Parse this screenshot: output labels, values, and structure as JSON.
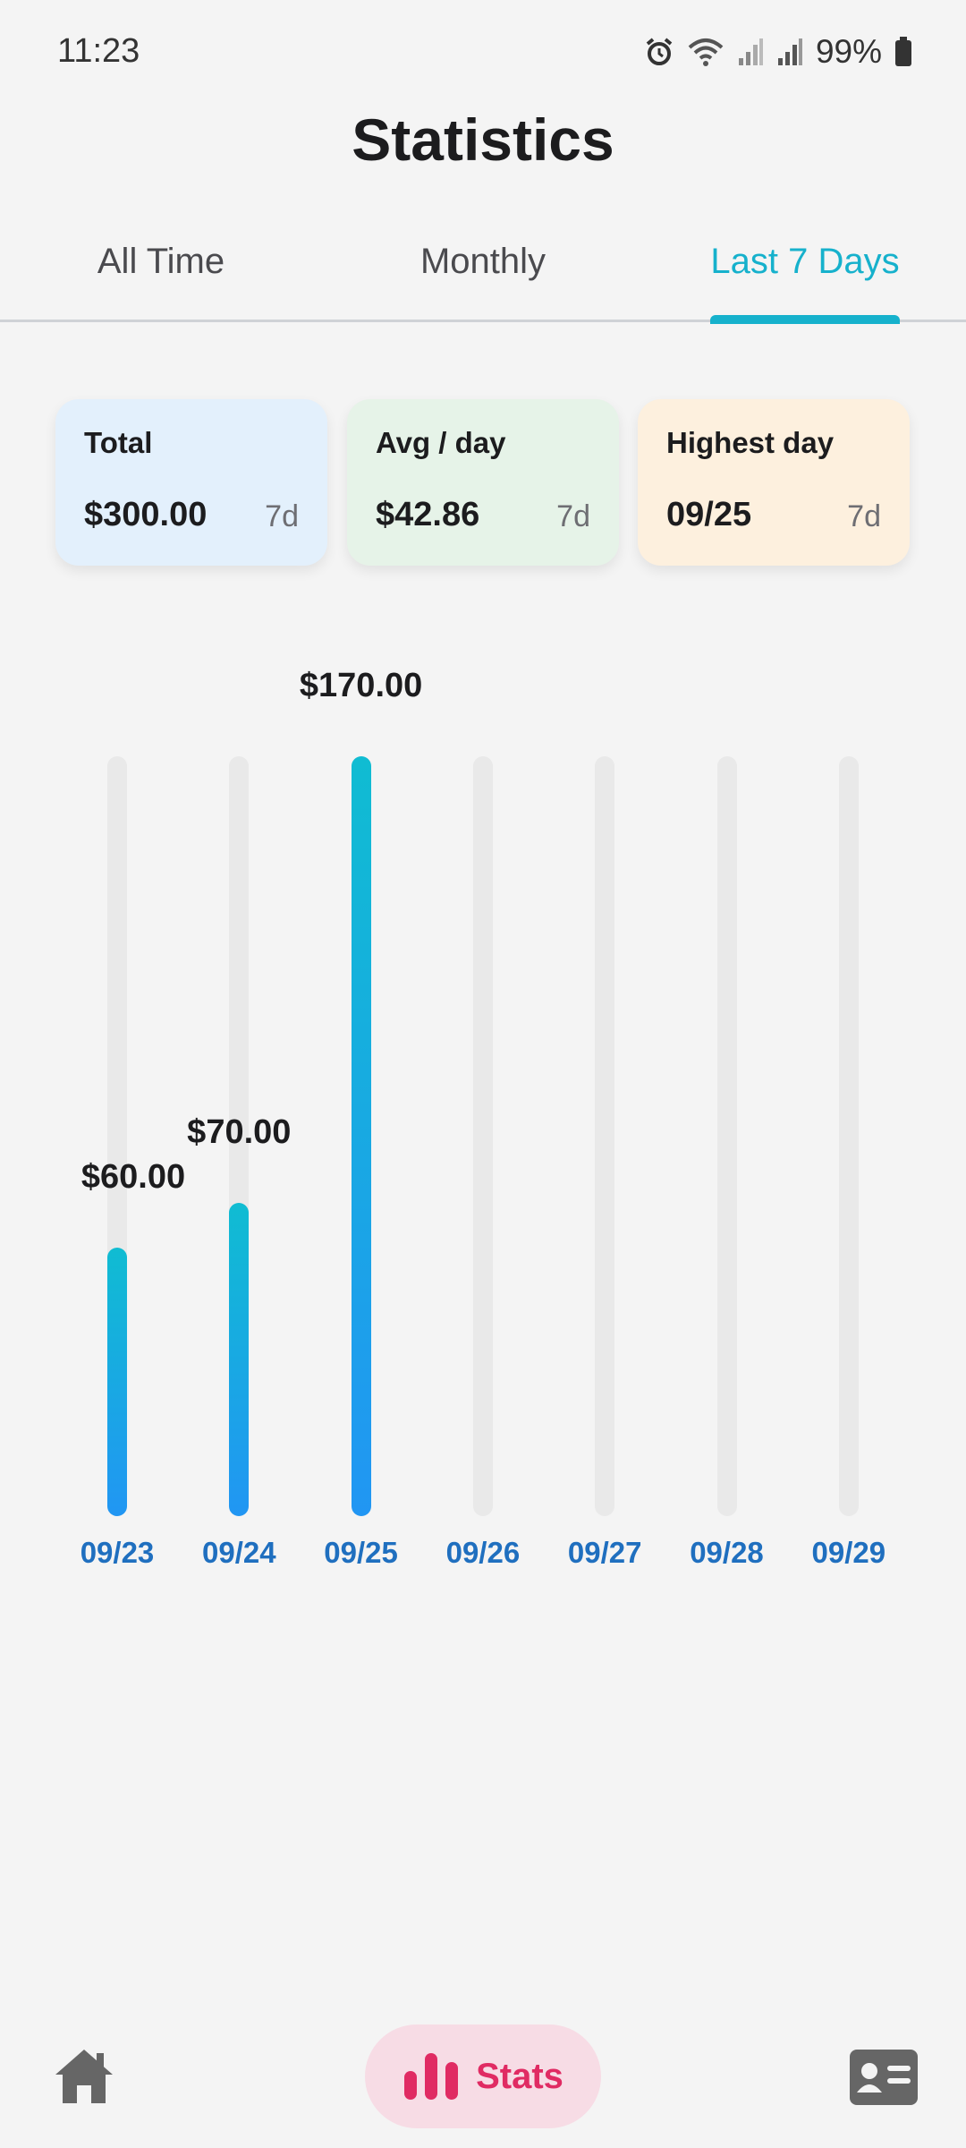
{
  "status_bar": {
    "time": "11:23",
    "battery": "99%",
    "icons": [
      "alarm-icon",
      "wifi-icon",
      "signal-icon",
      "signal-icon",
      "battery-icon"
    ]
  },
  "header": {
    "title": "Statistics"
  },
  "tabs": [
    {
      "label": "All Time",
      "active": false
    },
    {
      "label": "Monthly",
      "active": false
    },
    {
      "label": "Last 7 Days",
      "active": true
    }
  ],
  "summary_cards": [
    {
      "label": "Total",
      "value": "$300.00",
      "period": "7d",
      "bg": "#e3f0fc"
    },
    {
      "label": "Avg / day",
      "value": "$42.86",
      "period": "7d",
      "bg": "#e6f3e8"
    },
    {
      "label": "Highest day",
      "value": "09/25",
      "period": "7d",
      "bg": "#fdf0de"
    }
  ],
  "chart_data": {
    "type": "bar",
    "categories": [
      "09/23",
      "09/24",
      "09/25",
      "09/26",
      "09/27",
      "09/28",
      "09/29"
    ],
    "values": [
      60,
      70,
      170,
      0,
      0,
      0,
      0
    ],
    "value_labels": [
      "$60.00",
      "$70.00",
      "$170.00",
      "",
      "",
      "",
      ""
    ],
    "ylim": [
      0,
      170
    ],
    "title": "",
    "xlabel": "",
    "ylabel": "",
    "grid": false,
    "colors": {
      "bar_top": "#10bcd2",
      "bar_bottom": "#2196f3",
      "track": "#e9e9e9",
      "label": "#1f6fbf"
    }
  },
  "bottom_nav": {
    "home_icon": "home-icon",
    "stats_label": "Stats",
    "stats_icon": "bar-chart-icon",
    "profile_icon": "contact-card-icon",
    "accent": "#e02b63"
  },
  "accent_color": "#16b1cc"
}
